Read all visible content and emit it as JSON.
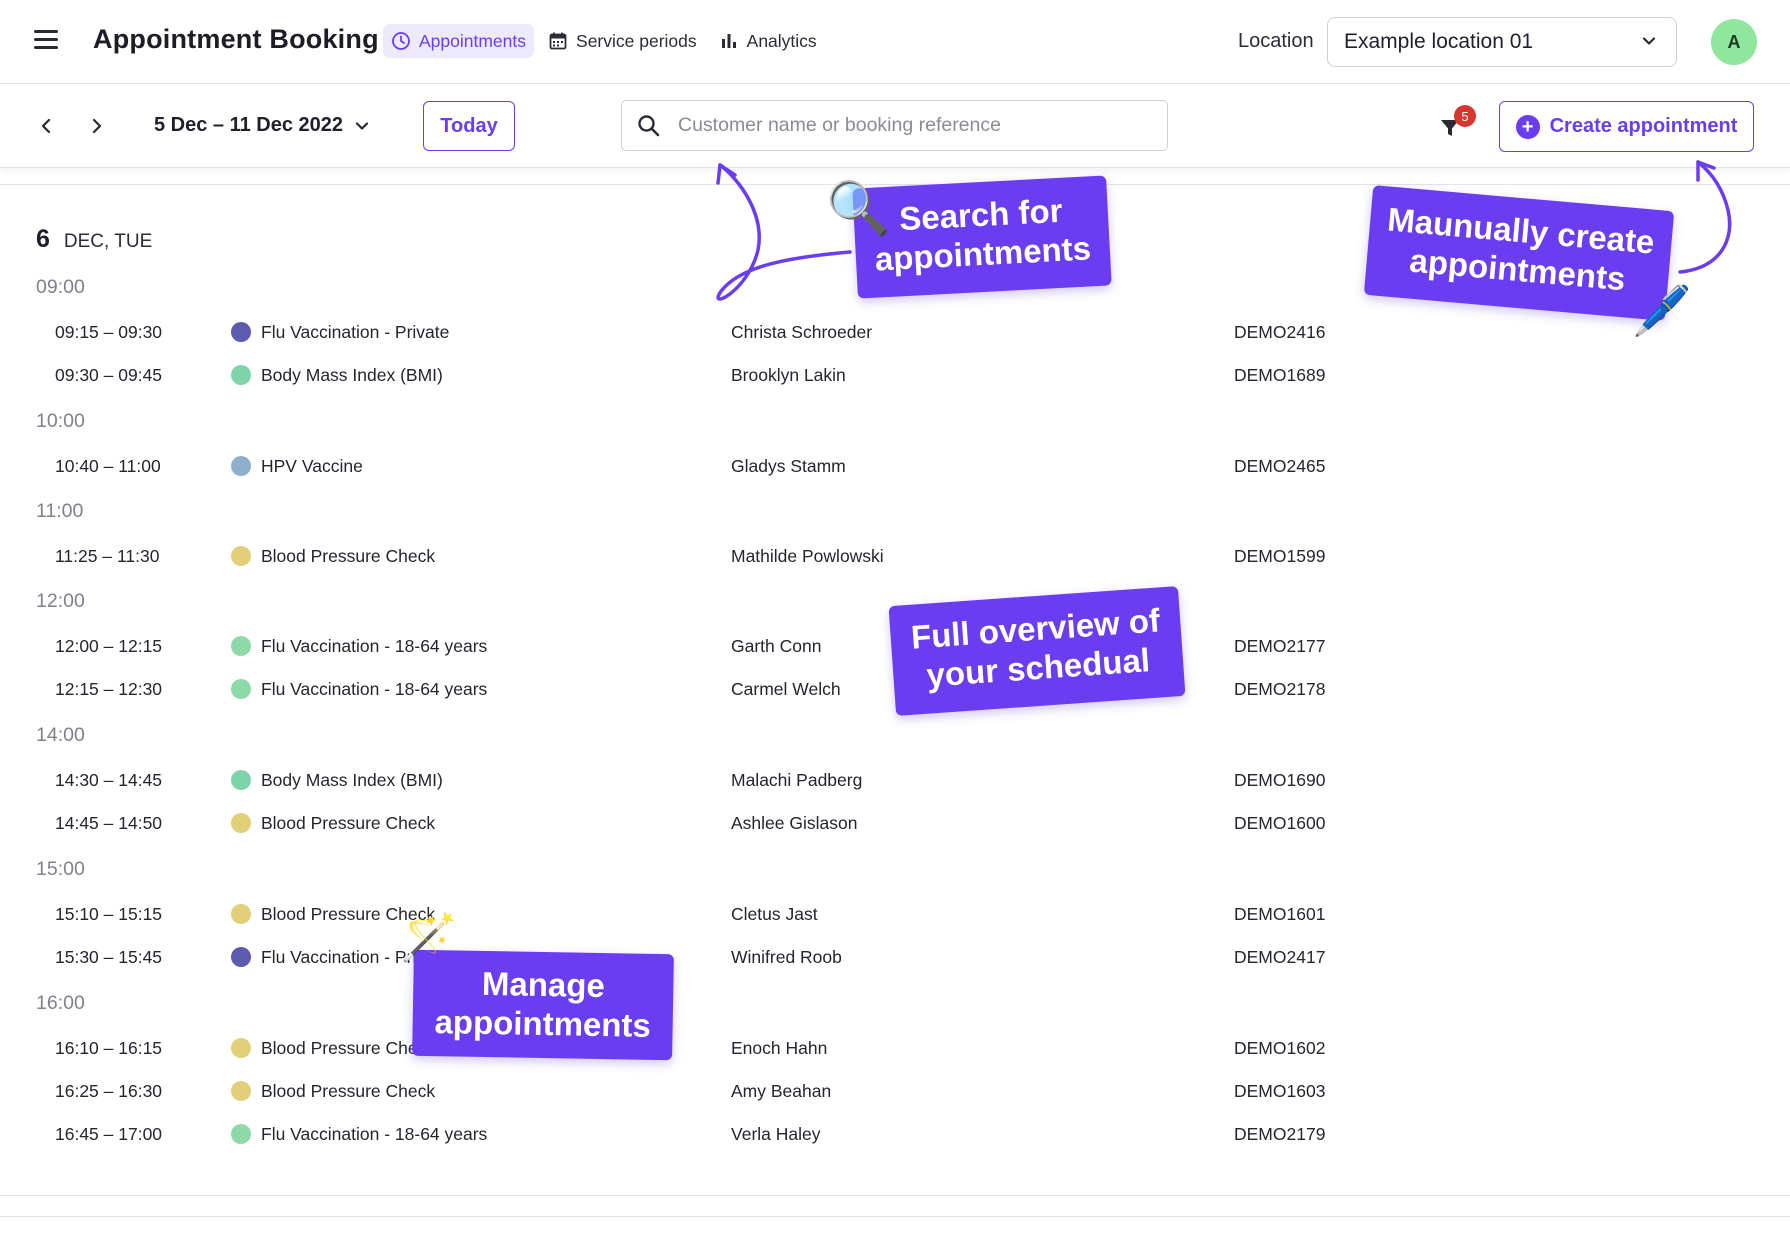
{
  "header": {
    "title": "Appointment Booking",
    "nav": [
      {
        "label": "Appointments",
        "icon": "clock-icon",
        "active": true
      },
      {
        "label": "Service periods",
        "icon": "calendar-icon",
        "active": false
      },
      {
        "label": "Analytics",
        "icon": "bar-chart-icon",
        "active": false
      }
    ],
    "location_label": "Location",
    "location_value": "Example location 01",
    "avatar_initial": "A"
  },
  "toolbar": {
    "date_range": "5 Dec – 11 Dec 2022",
    "today_label": "Today",
    "search_placeholder": "Customer name or booking reference",
    "filter_count": "5",
    "create_label": "Create appointment"
  },
  "day": {
    "number": "6",
    "name": "DEC, TUE"
  },
  "hours": [
    "09:00",
    "10:00",
    "11:00",
    "12:00",
    "14:00",
    "15:00",
    "16:00"
  ],
  "appointments": [
    {
      "time": "09:15 – 09:30",
      "service": "Flu Vaccination - Private",
      "color": "#5b5bb0",
      "customer": "Christa Schroeder",
      "ref": "DEMO2416"
    },
    {
      "time": "09:30 – 09:45",
      "service": "Body Mass Index (BMI)",
      "color": "#7fd3a8",
      "customer": "Brooklyn Lakin",
      "ref": "DEMO1689"
    },
    {
      "time": "10:40 – 11:00",
      "service": "HPV Vaccine",
      "color": "#8fb0cc",
      "customer": "Gladys Stamm",
      "ref": "DEMO2465"
    },
    {
      "time": "11:25 – 11:30",
      "service": "Blood Pressure Check",
      "color": "#e2cf7a",
      "customer": "Mathilde Powlowski",
      "ref": "DEMO1599"
    },
    {
      "time": "12:00 – 12:15",
      "service": "Flu Vaccination - 18-64 years",
      "color": "#8ed9a8",
      "customer": "Garth Conn",
      "ref": "DEMO2177"
    },
    {
      "time": "12:15 – 12:30",
      "service": "Flu Vaccination - 18-64 years",
      "color": "#8ed9a8",
      "customer": "Carmel Welch",
      "ref": "DEMO2178"
    },
    {
      "time": "14:30 – 14:45",
      "service": "Body Mass Index (BMI)",
      "color": "#7fd3a8",
      "customer": "Malachi Padberg",
      "ref": "DEMO1690"
    },
    {
      "time": "14:45 – 14:50",
      "service": "Blood Pressure Check",
      "color": "#e2cf7a",
      "customer": "Ashlee Gislason",
      "ref": "DEMO1600"
    },
    {
      "time": "15:10 – 15:15",
      "service": "Blood Pressure Check",
      "color": "#e2cf7a",
      "customer": "Cletus Jast",
      "ref": "DEMO1601"
    },
    {
      "time": "15:30 – 15:45",
      "service": "Flu Vaccination - Private",
      "color": "#5b5bb0",
      "customer": "Winifred Roob",
      "ref": "DEMO2417"
    },
    {
      "time": "16:10 – 16:15",
      "service": "Blood Pressure Check",
      "color": "#e2cf7a",
      "customer": "Enoch Hahn",
      "ref": "DEMO1602"
    },
    {
      "time": "16:25 – 16:30",
      "service": "Blood Pressure Check",
      "color": "#e2cf7a",
      "customer": "Amy Beahan",
      "ref": "DEMO1603"
    },
    {
      "time": "16:45 – 17:00",
      "service": "Flu Vaccination - 18-64 years",
      "color": "#8ed9a8",
      "customer": "Verla Haley",
      "ref": "DEMO2179"
    }
  ],
  "callouts": {
    "search": "Search for appointments",
    "create": "Maunually create appointments",
    "overview": "Full overview of your schedual",
    "manage": "Manage appointments"
  },
  "colors": {
    "accent": "#6a3df0",
    "accent_light": "#ede9fe",
    "badge": "#d8372f",
    "avatar": "#8ee79d"
  }
}
